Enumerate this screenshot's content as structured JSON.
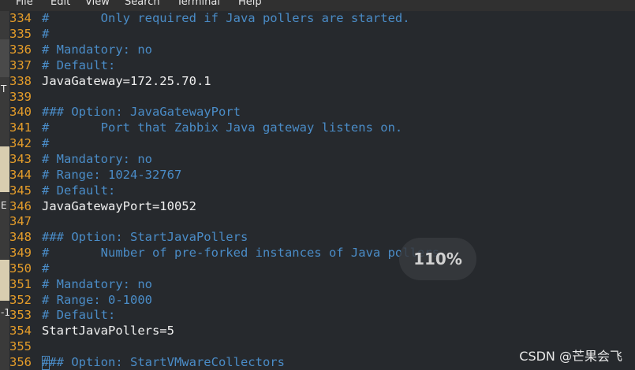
{
  "menubar": {
    "items": [
      "File",
      "Edit",
      "View",
      "Search",
      "Terminal",
      "Help"
    ]
  },
  "desktop": {
    "glyphs": [
      "T",
      "E",
      "-1"
    ]
  },
  "editor": {
    "lines": [
      {
        "num": "334",
        "text": "#       Only required if Java pollers are started.",
        "kind": "comment"
      },
      {
        "num": "335",
        "text": "#",
        "kind": "comment"
      },
      {
        "num": "336",
        "text": "# Mandatory: no",
        "kind": "comment"
      },
      {
        "num": "337",
        "text": "# Default:",
        "kind": "comment"
      },
      {
        "num": "338",
        "text": "JavaGateway=172.25.70.1",
        "kind": "plain"
      },
      {
        "num": "339",
        "text": "",
        "kind": "plain"
      },
      {
        "num": "340",
        "text": "### Option: JavaGatewayPort",
        "kind": "comment"
      },
      {
        "num": "341",
        "text": "#       Port that Zabbix Java gateway listens on.",
        "kind": "comment"
      },
      {
        "num": "342",
        "text": "#",
        "kind": "comment"
      },
      {
        "num": "343",
        "text": "# Mandatory: no",
        "kind": "comment"
      },
      {
        "num": "344",
        "text": "# Range: 1024-32767",
        "kind": "comment"
      },
      {
        "num": "345",
        "text": "# Default:",
        "kind": "comment"
      },
      {
        "num": "346",
        "text": "JavaGatewayPort=10052",
        "kind": "plain"
      },
      {
        "num": "347",
        "text": "",
        "kind": "plain"
      },
      {
        "num": "348",
        "text": "### Option: StartJavaPollers",
        "kind": "comment"
      },
      {
        "num": "349",
        "text": "#       Number of pre-forked instances of Java pollers.",
        "kind": "comment"
      },
      {
        "num": "350",
        "text": "#",
        "kind": "comment"
      },
      {
        "num": "351",
        "text": "# Mandatory: no",
        "kind": "comment"
      },
      {
        "num": "352",
        "text": "# Range: 0-1000",
        "kind": "comment"
      },
      {
        "num": "353",
        "text": "# Default:",
        "kind": "comment"
      },
      {
        "num": "354",
        "text": "StartJavaPollers=5",
        "kind": "plain"
      },
      {
        "num": "355",
        "text": "",
        "kind": "plain"
      },
      {
        "num": "356",
        "text": "### Option: StartVMwareCollectors",
        "kind": "comment"
      }
    ]
  },
  "overlay": {
    "zoom_level": "110%",
    "watermark": "CSDN @芒果会飞"
  },
  "colors": {
    "line_number": "#e59d2a",
    "comment": "#4a8cc7",
    "plain": "#f0f0f0",
    "background": "#26292d"
  }
}
